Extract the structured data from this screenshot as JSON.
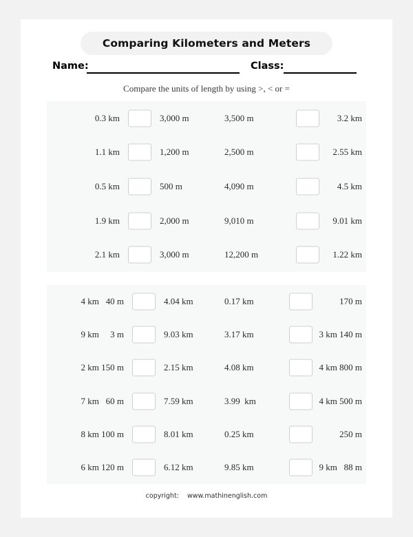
{
  "header": {
    "title": "Comparing Kilometers and Meters",
    "name_label": "Name:",
    "class_label": "Class:",
    "instruction": "Compare the units of length by using >, < or ="
  },
  "footer": {
    "text": "copyright:    www.mathinenglish.com"
  },
  "colors": {
    "page_background": "#f2f2f2",
    "sheet": "#ffffff",
    "panel": "#f7f8f8",
    "title_pill": "#f2f2f2",
    "box_border": "#cfcfcf",
    "text": "#2b2b2b"
  },
  "sections": [
    {
      "id": "section-1",
      "rows": [
        {
          "left": "0.3 km",
          "right": "3,000 m",
          "left2": "3,500 m",
          "right2": "3.2 km"
        },
        {
          "left": "1.1 km",
          "right": "1,200 m",
          "left2": "2,500 m",
          "right2": "2.55 km"
        },
        {
          "left": "0.5 km",
          "right": "500 m",
          "left2": "4,090 m",
          "right2": "4.5 km"
        },
        {
          "left": "1.9 km",
          "right": "2,000 m",
          "left2": "9,010 m",
          "right2": "9.01 km"
        },
        {
          "left": "2.1 km",
          "right": "3,000 m",
          "left2": "12,200 m",
          "right2": "1.22 km"
        }
      ]
    },
    {
      "id": "section-2",
      "rows": [
        {
          "left": "4 km   40 m",
          "right": "4.04 km",
          "left2": "0.17 km",
          "right2": "170 m"
        },
        {
          "left": "9 km     3 m",
          "right": "9.03 km",
          "left2": "3.17 km",
          "right2": "3 km 140 m"
        },
        {
          "left": "2 km 150 m",
          "right": "2.15 km",
          "left2": "4.08 km",
          "right2": "4 km 800 m"
        },
        {
          "left": "7 km   60 m",
          "right": "7.59 km",
          "left2": "3.99  km",
          "right2": "4 km 500 m"
        },
        {
          "left": "8 km 100 m",
          "right": "8.01 km",
          "left2": "0.25 km",
          "right2": "250 m"
        },
        {
          "left": "6 km 120 m",
          "right": "6.12 km",
          "left2": "9.85 km",
          "right2": "9 km   88 m"
        }
      ]
    }
  ]
}
